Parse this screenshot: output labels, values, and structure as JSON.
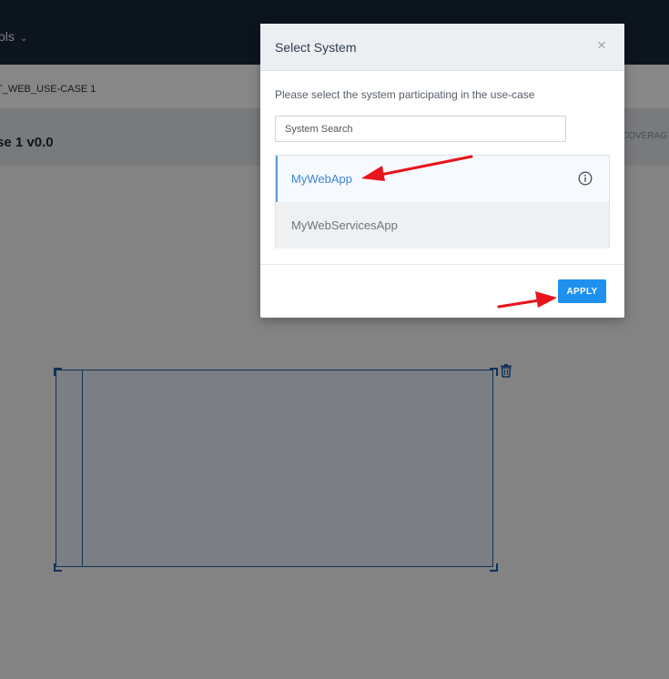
{
  "app": {
    "topbar": {
      "menu_label": "ols",
      "chevron_icon": "chevron-down-icon"
    },
    "breadcrumb": "T_WEB_USE-CASE 1",
    "page_title": "se 1 v0.0",
    "coverage_label": "COVERAG",
    "canvas": {
      "delete_icon": "trash-icon"
    }
  },
  "modal": {
    "title": "Select System",
    "close_label": "×",
    "instruction": "Please select the system participating in the use-case",
    "search": {
      "placeholder": "System Search",
      "value": ""
    },
    "systems": [
      {
        "label": "MyWebApp",
        "selected": true,
        "icon": "info-icon"
      },
      {
        "label": "MyWebServicesApp",
        "selected": false
      }
    ],
    "apply_label": "APPLY"
  },
  "annotations": {
    "arrow_color": "#e8141b",
    "arrows": [
      "arrow-to-mywebapp",
      "arrow-to-apply"
    ]
  },
  "colors": {
    "topbar_bg": "#17283a",
    "accent": "#1e90f0",
    "selected_text": "#3d86d6",
    "diagram_stroke": "#1f5fa8"
  }
}
